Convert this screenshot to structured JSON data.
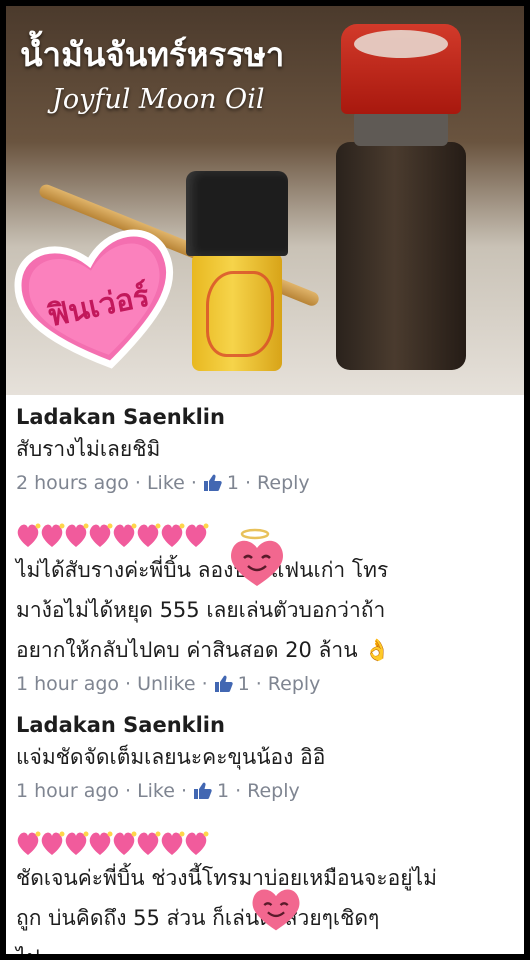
{
  "photo": {
    "title_th": "น้ำมันจันทร์หรรษา",
    "title_en": "Joyful Moon Oil",
    "sticker_text": "ฟินเว่อร์"
  },
  "comments": [
    {
      "author": "Ladakan Saenklin",
      "text": "สับรางไม่เลยชิมิ",
      "time": "2 hours ago",
      "like_label": "Like",
      "like_count": "1",
      "reply_label": "Reply"
    },
    {
      "author": "",
      "text_lines": [
        "ไม่ได้สับรางค่ะพี่บิ้น    ลองป้ายแฟนเก่า โทร",
        "มาง้อไม่ได้หยุด 555 เลยเล่นตัวบอกว่าถ้า",
        "อยากให้กลับไปคบ ค่าสินสอด 20 ล้าน 👌"
      ],
      "time": "1 hour ago",
      "like_label": "Unlike",
      "like_count": "1",
      "reply_label": "Reply"
    },
    {
      "author": "Ladakan Saenklin",
      "text": "แจ่มชัดจัดเต็มเลยนะคะขุนน้อง อิอิ",
      "time": "1 hour ago",
      "like_label": "Like",
      "like_count": "1",
      "reply_label": "Reply"
    },
    {
      "author": "",
      "text_lines": [
        "ชัดเจนค่ะพี่บิ้น ช่วงนี้โทรมาบ่อยเหมือนจะอยู่ไม่",
        "ถูก บ่นคิดถึง 55 ส่วน     ก็เล่นตัวสวยๆเชิดๆ",
        "ไป"
      ]
    }
  ],
  "colors": {
    "meta_text": "#7f8591",
    "like_blue": "#4267b2",
    "heart_pink": "#f15b9c"
  }
}
